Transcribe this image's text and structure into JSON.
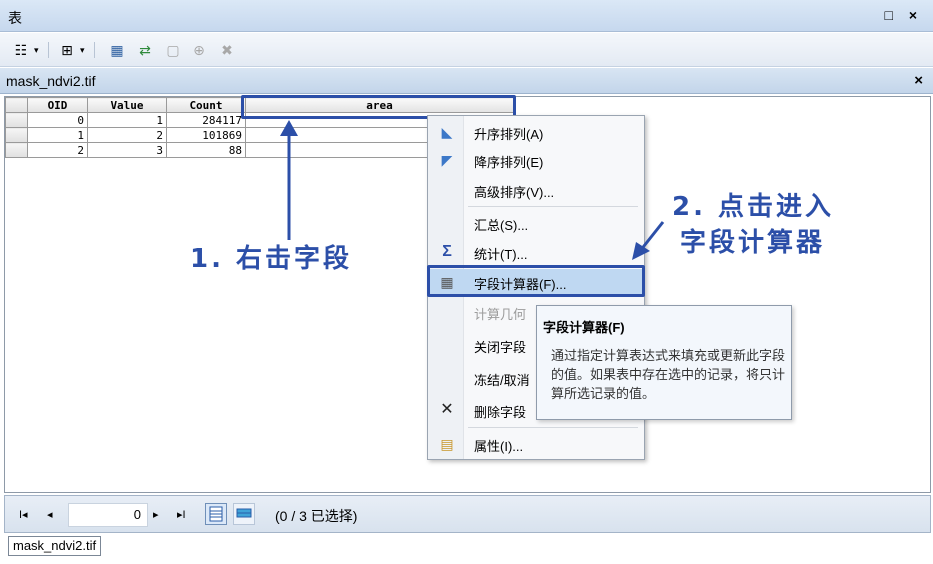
{
  "window": {
    "title": "表",
    "controls": "□ ×"
  },
  "toolbar": {
    "table_options": "☷",
    "related": "⊞",
    "select_by_attr": "▦",
    "switch_selection": "⇄",
    "clear_selection": "▢",
    "zoom_selected": "⊕",
    "delete_selected": "✖"
  },
  "tab": {
    "name": "mask_ndvi2.tif",
    "close": "×"
  },
  "grid": {
    "columns": [
      "OID",
      "Value",
      "Count",
      "area"
    ],
    "rows": [
      [
        "0",
        "1",
        "284117",
        ""
      ],
      [
        "1",
        "2",
        "101869",
        ""
      ],
      [
        "2",
        "3",
        "88",
        ""
      ]
    ]
  },
  "context_menu": {
    "items": [
      {
        "icon": "sort-ascending-icon",
        "label": "升序排列(A)"
      },
      {
        "icon": "sort-descending-icon",
        "label": "降序排列(E)"
      },
      {
        "icon": "",
        "label": "高级排序(V)..."
      },
      {
        "icon": "",
        "label": "汇总(S)..."
      },
      {
        "icon": "sigma-icon",
        "label": "统计(T)..."
      },
      {
        "icon": "calculator-icon",
        "label": "字段计算器(F)..."
      },
      {
        "icon": "",
        "label": "计算几何"
      },
      {
        "icon": "",
        "label": "关闭字段"
      },
      {
        "icon": "",
        "label": "冻结/取消"
      },
      {
        "icon": "delete-icon",
        "label": "删除字段"
      },
      {
        "icon": "properties-icon",
        "label": "属性(I)..."
      }
    ]
  },
  "tooltip": {
    "title": "字段计算器(F)",
    "body": "通过指定计算表达式来填充或更新此字段的值。如果表中存在选中的记录，将只计算所选记录的值。"
  },
  "annotations": {
    "step1": "1. 右击字段",
    "step2_line1": "2. 点击进入",
    "step2_line2": "字段计算器"
  },
  "navbar": {
    "first": "I◂",
    "prev": "◂",
    "current_record": "0",
    "next": "▸",
    "last": "▸I",
    "status": "(0 / 3 已选择)"
  },
  "bottom_tab": {
    "name": "mask_ndvi2.tif"
  },
  "colors": {
    "annotation": "#2c4fa8",
    "highlight_row": "#bfd8f2"
  }
}
